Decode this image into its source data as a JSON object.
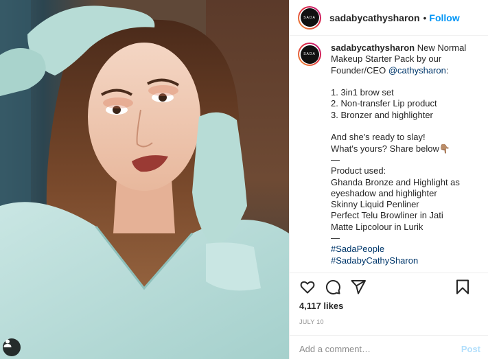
{
  "post": {
    "username": "sadabycathysharon",
    "follow_label": "Follow",
    "dot": "•",
    "avatar_text": "SADA"
  },
  "caption": {
    "username": "sadabycathysharon",
    "lines": [
      {
        "text": "New Normal Makeup Starter Pack by our Founder/CEO ",
        "mention": "@cathysharon",
        "suffix": ":"
      },
      {
        "text": ""
      },
      {
        "text": "1. 3in1 brow set"
      },
      {
        "text": "2. Non-transfer Lip product"
      },
      {
        "text": "3. Bronzer and highlighter"
      },
      {
        "text": ""
      },
      {
        "text": "And she's ready to slay!"
      },
      {
        "text": "What's yours? Share below👇🏽"
      },
      {
        "text": "—"
      },
      {
        "text": "Product used:"
      },
      {
        "text": "Ghanda Bronze and Highlight as eyeshadow and highlighter"
      },
      {
        "text": "Skinny Liquid Penliner"
      },
      {
        "text": "Perfect Telu Browliner in Jati"
      },
      {
        "text": "Matte Lipcolour in Lurik"
      },
      {
        "text": "—"
      },
      {
        "hashtag": "#SadaPeople"
      },
      {
        "hashtag": "#SadabyCathySharon"
      }
    ]
  },
  "actions": {
    "likes": "4,117 likes",
    "date": "JULY 10"
  },
  "comment": {
    "placeholder": "Add a comment…",
    "post_label": "Post"
  },
  "icons": {
    "like": "heart-icon",
    "comment": "comment-bubble-icon",
    "share": "paper-plane-icon",
    "save": "bookmark-icon",
    "tags": "user-tag-icon"
  },
  "colors": {
    "link": "#0095f6",
    "hashtag": "#00376b",
    "muted": "#8e8e8e",
    "post_disabled": "#b2dffc"
  }
}
